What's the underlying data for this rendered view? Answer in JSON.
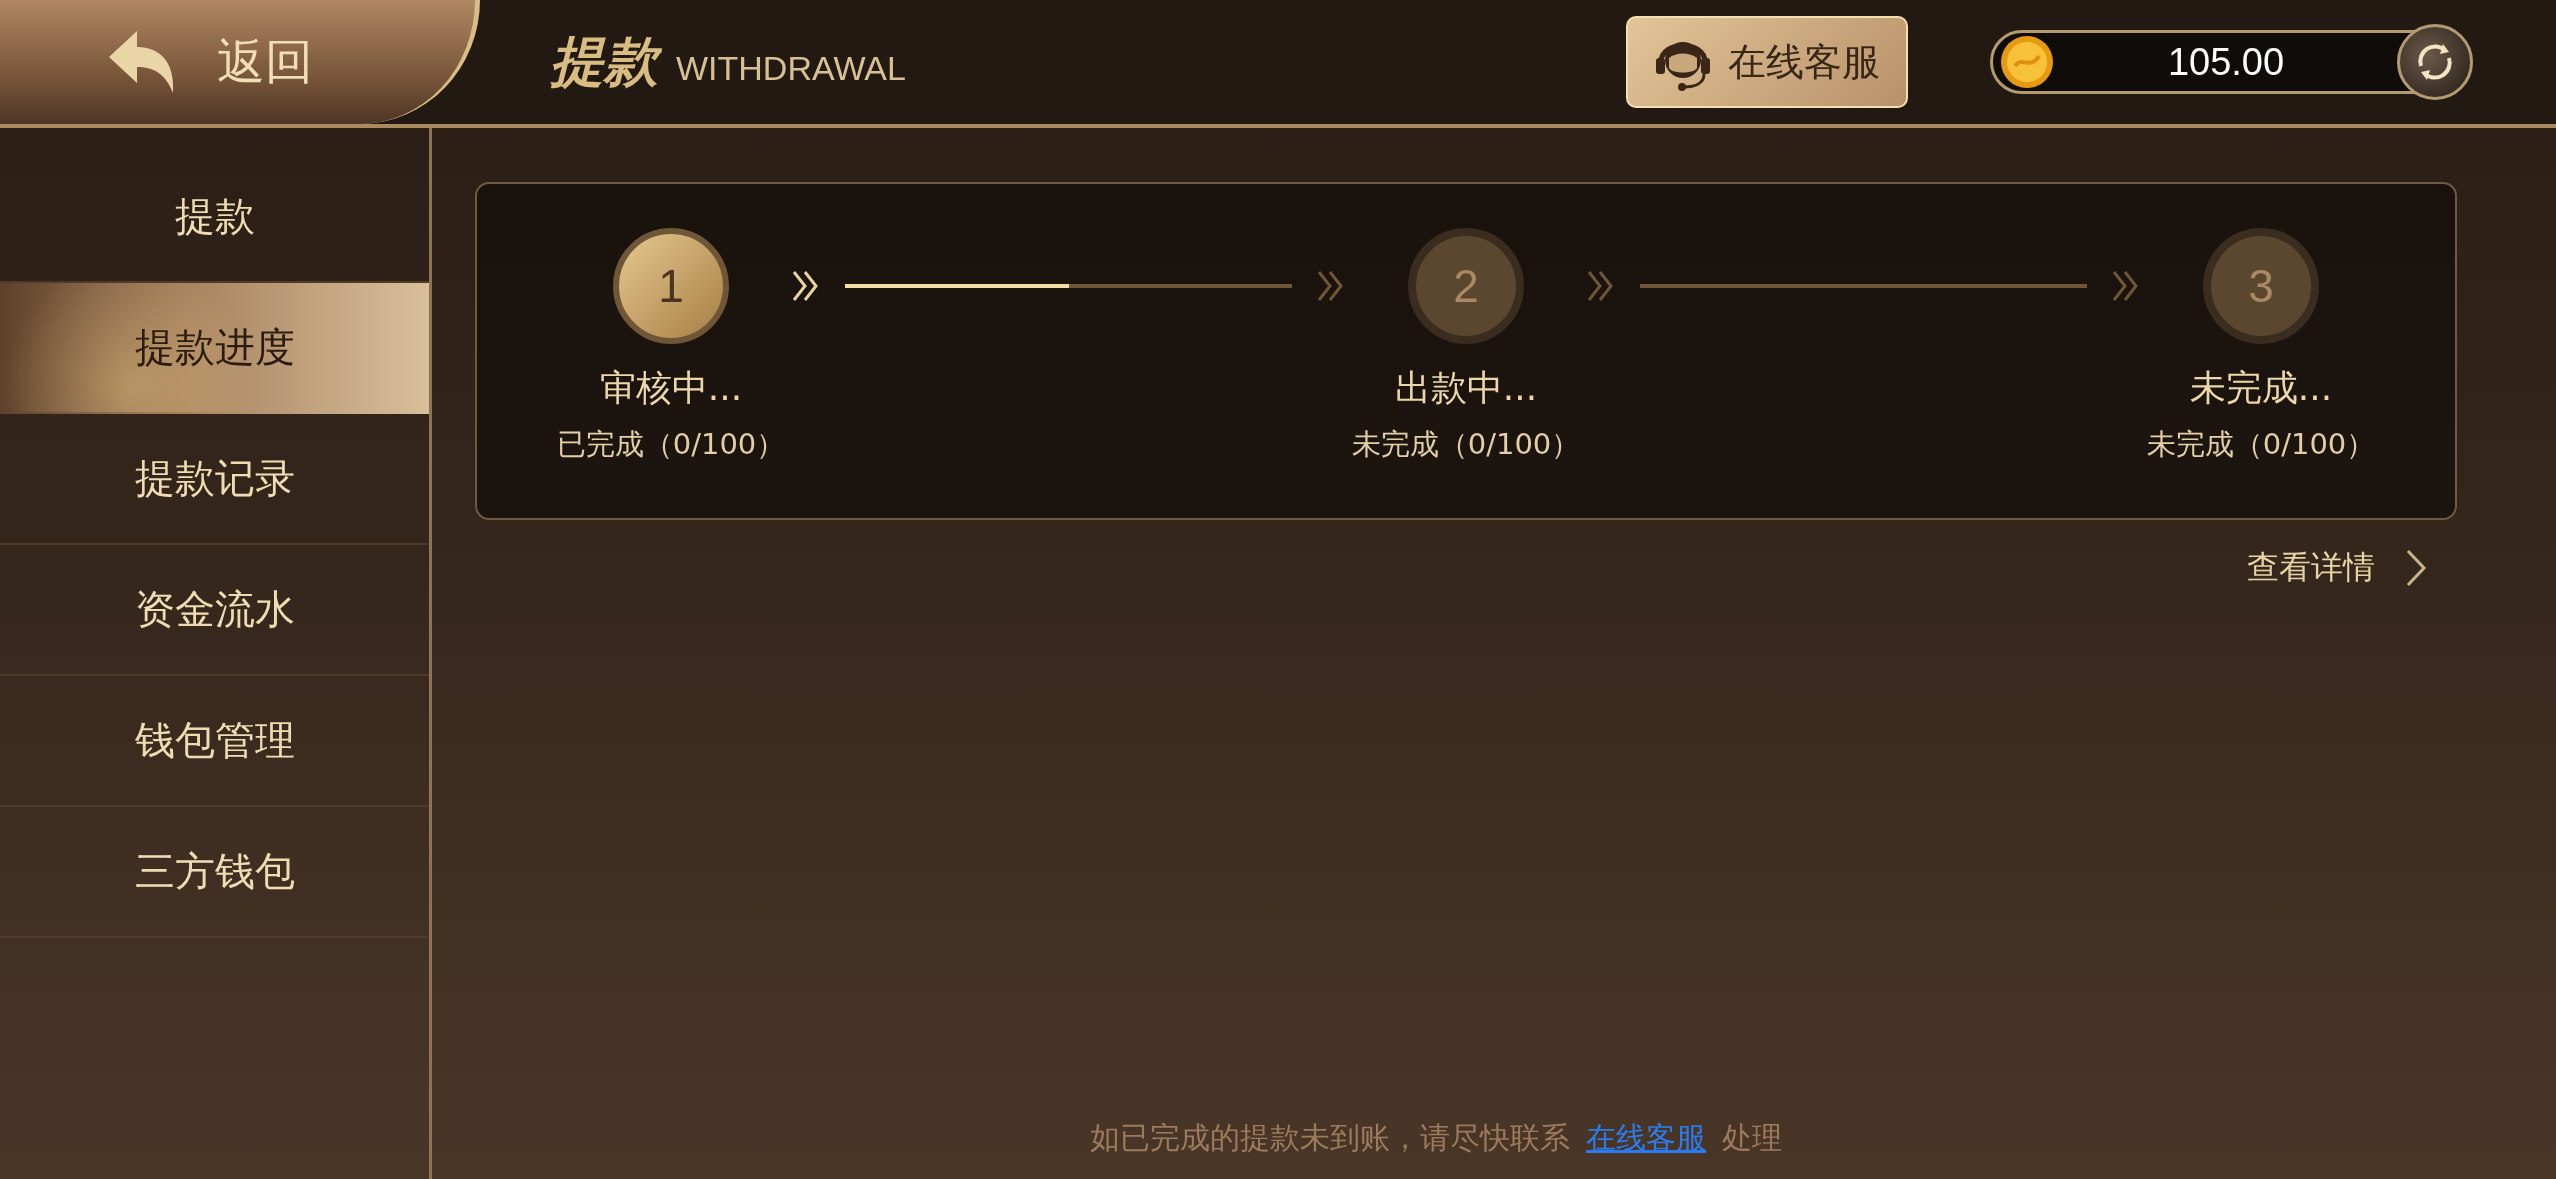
{
  "header": {
    "back_label": "返回",
    "title": "提款",
    "title_en": "WITHDRAWAL",
    "service_button": "在线客服",
    "balance": "105.00"
  },
  "sidebar": {
    "items": [
      {
        "label": "提款",
        "selected": false
      },
      {
        "label": "提款进度",
        "selected": true
      },
      {
        "label": "提款记录",
        "selected": false
      },
      {
        "label": "资金流水",
        "selected": false
      },
      {
        "label": "钱包管理",
        "selected": false
      },
      {
        "label": "三方钱包",
        "selected": false
      }
    ]
  },
  "progress": {
    "steps": [
      {
        "number": "1",
        "label": "审核中...",
        "status": "已完成（0/100）",
        "active": true
      },
      {
        "number": "2",
        "label": "出款中...",
        "status": "未完成（0/100）",
        "active": false
      },
      {
        "number": "3",
        "label": "未完成...",
        "status": "未完成（0/100）",
        "active": false
      }
    ],
    "level": 0.5
  },
  "details_link": "查看详情",
  "footer": {
    "text": "如已完成的提款未到账，请尽快联系",
    "link": "在线客服",
    "suffix": "处理"
  }
}
